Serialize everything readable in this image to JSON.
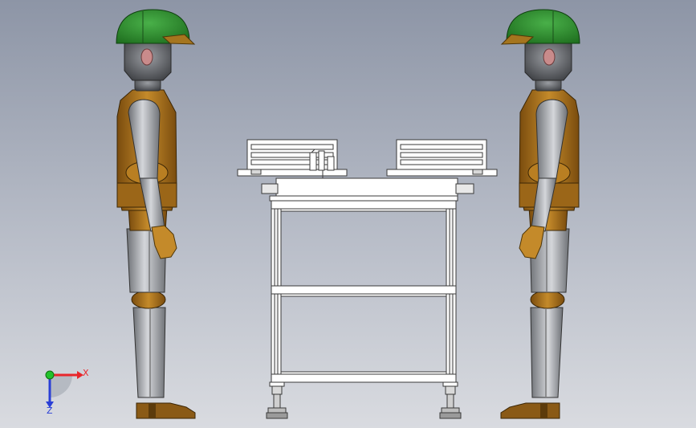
{
  "triad": {
    "x_label": "X",
    "z_label": "Z",
    "x_color": "#e8262b",
    "y_color": "#22c22b",
    "z_color": "#2a3fd6"
  },
  "colors": {
    "helmet": "#2f8f2f",
    "visor": "#a5751e",
    "vest": "#9b6618",
    "skin_metal": "#8f9297",
    "boot": "#8a5a16",
    "frame": "#ffffff",
    "frame_stroke": "#3a3a3a"
  }
}
